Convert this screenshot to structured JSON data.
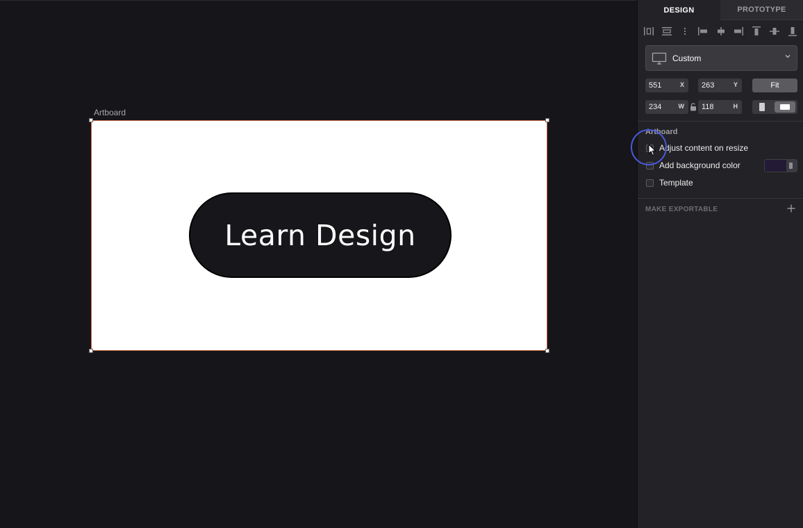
{
  "canvas": {
    "artboard_title": "Artboard",
    "button_text": "Learn Design"
  },
  "inspector": {
    "tabs": [
      {
        "label": "DESIGN",
        "active": true
      },
      {
        "label": "PROTOTYPE",
        "active": false
      }
    ],
    "align_icons": [
      "align-distribute-horizontal-icon",
      "align-distribute-vertical-icon",
      "more-vertical-icon",
      "align-left-icon",
      "align-center-horizontal-icon",
      "align-right-icon",
      "align-top-icon",
      "align-middle-icon",
      "align-bottom-icon"
    ],
    "preset": {
      "label": "Custom",
      "icon": "monitor-icon"
    },
    "x": {
      "value": "551",
      "unit": "X"
    },
    "y": {
      "value": "263",
      "unit": "Y"
    },
    "w": {
      "value": "234",
      "unit": "W"
    },
    "h": {
      "value": "118",
      "unit": "H"
    },
    "fit_label": "Fit",
    "orientation": "landscape",
    "artboard_section": {
      "title": "Artboard",
      "options": [
        {
          "label": "Adjust content on resize",
          "checked": false
        },
        {
          "label": "Add background color",
          "checked": false
        },
        {
          "label": "Template",
          "checked": false
        }
      ],
      "background_color": "#231a35"
    },
    "make_exportable_label": "MAKE EXPORTABLE"
  },
  "colors": {
    "canvas_bg": "#161519",
    "panel_bg": "#232226",
    "cursor_highlight": "#4a5ae0"
  }
}
